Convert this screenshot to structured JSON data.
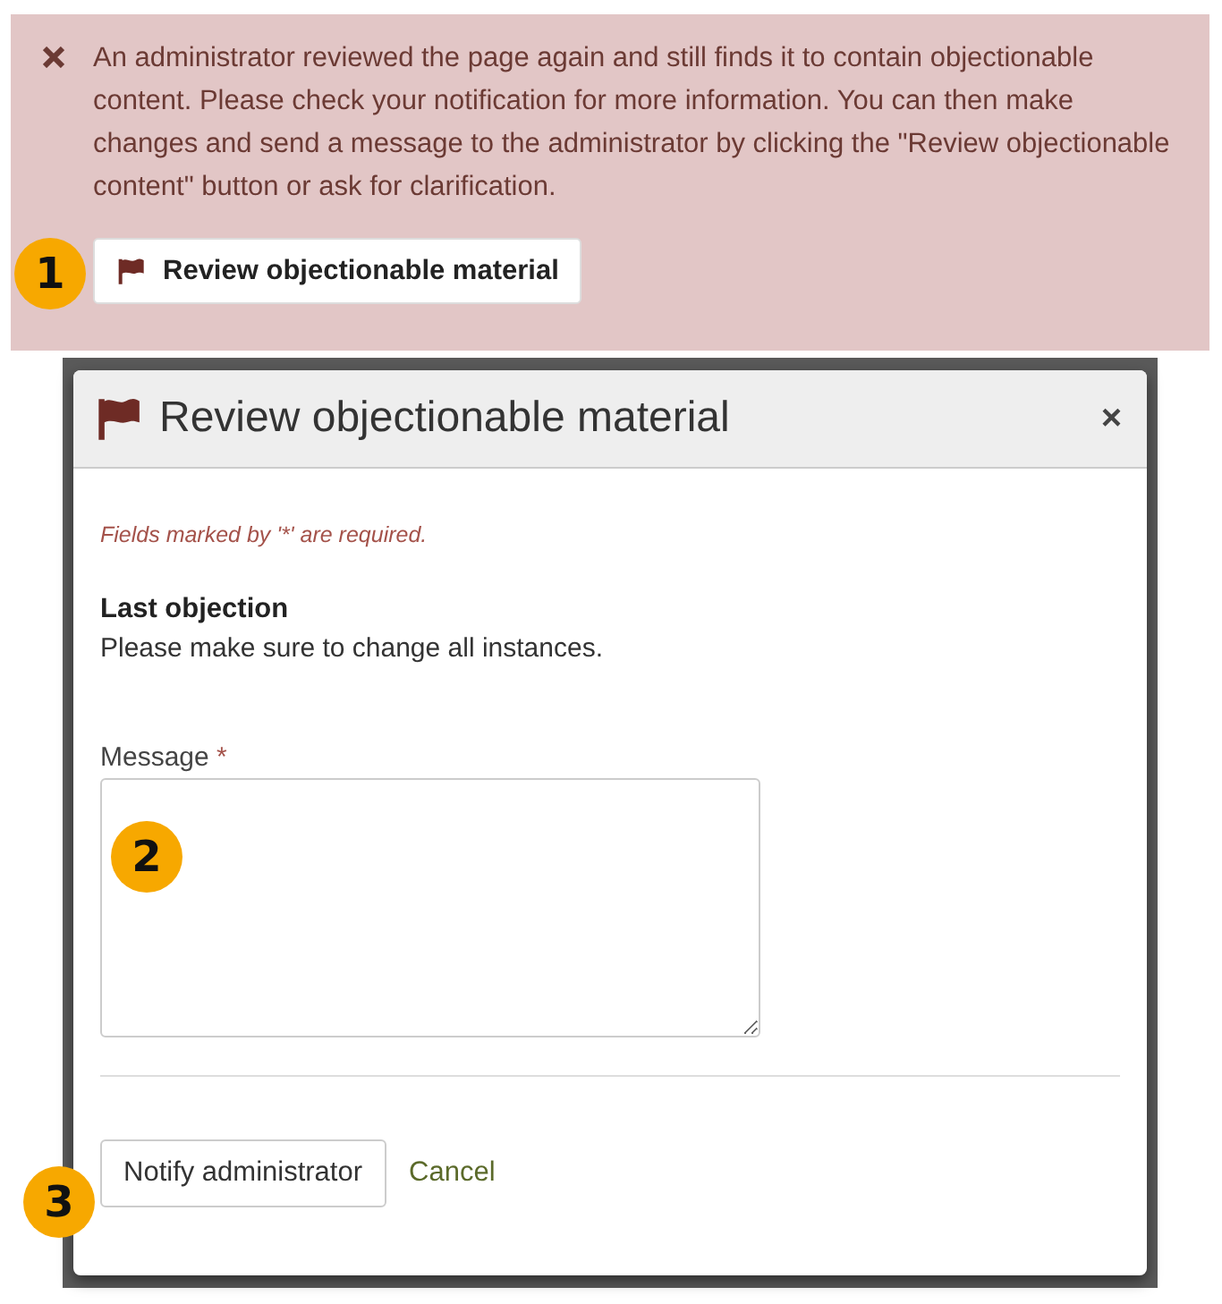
{
  "alert": {
    "message": "An administrator reviewed the page again and still finds it to contain objectionable content. Please check your notification for more information. You can then make changes and send a message to the administrator by clicking the \"Review objectionable content\" button or ask for clarification.",
    "button": "Review objectionable material",
    "callout": "1"
  },
  "dialog": {
    "title": "Review objectionable material",
    "close": "×",
    "required_note": "Fields marked by '*' are required.",
    "section_heading": "Last objection",
    "section_text": "Please make sure to change all instances.",
    "field_label": "Message",
    "required_mark": "*",
    "field_callout": "2",
    "submit": "Notify administrator",
    "submit_callout": "3",
    "cancel": "Cancel"
  }
}
